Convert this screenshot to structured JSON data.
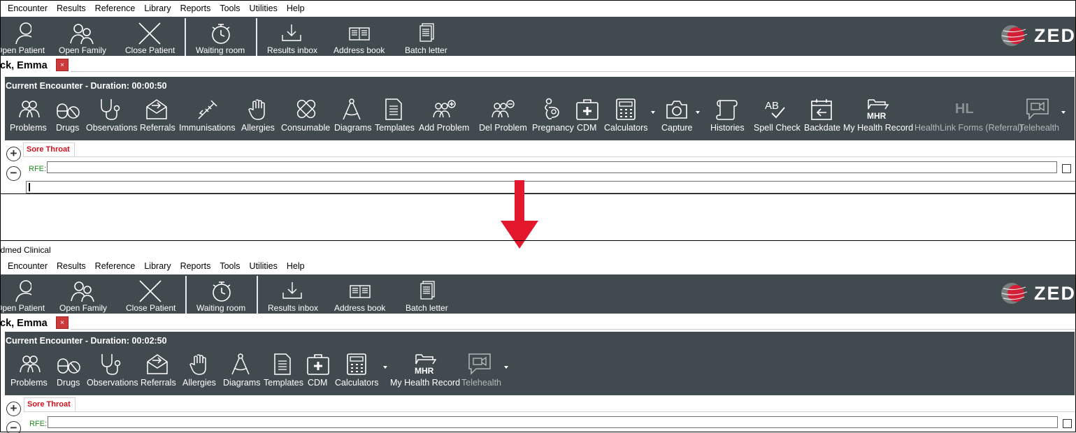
{
  "app": {
    "title": "edmed Clinical"
  },
  "menu": [
    "Encounter",
    "Results",
    "Reference",
    "Library",
    "Reports",
    "Tools",
    "Utilities",
    "Help"
  ],
  "toolbar": {
    "open_patient": "Open Patient",
    "open_family": "Open Family",
    "close_patient": "Close Patient",
    "waiting_room": "Waiting room",
    "results_inbox": "Results inbox",
    "address_book": "Address book",
    "batch_letter": "Batch letter"
  },
  "logo": {
    "text": "ZED"
  },
  "patient": {
    "name": "ck, Emma",
    "close": "×"
  },
  "encounter_top": {
    "title": "Current Encounter - Duration: 00:00:50",
    "buttons": {
      "problems": "Problems",
      "drugs": "Drugs",
      "observations": "Observations",
      "referrals": "Referrals",
      "immunisations": "Immunisations",
      "allergies": "Allergies",
      "consumable": "Consumable",
      "diagrams": "Diagrams",
      "templates": "Templates",
      "add_problem": "Add Problem",
      "del_problem": "Del Problem",
      "pregnancy": "Pregnancy",
      "cdm": "CDM",
      "calculators": "Calculators",
      "capture": "Capture",
      "histories": "Histories",
      "spell_check": "Spell Check",
      "backdate": "Backdate",
      "my_health_record": "My Health Record",
      "healthlink": "HealthLink Forms (Referral)",
      "telehealth": "Telehealth"
    }
  },
  "encounter_bottom": {
    "title": "Current Encounter - Duration: 00:02:50",
    "buttons": {
      "problems": "Problems",
      "drugs": "Drugs",
      "observations": "Observations",
      "referrals": "Referrals",
      "allergies": "Allergies",
      "diagrams": "Diagrams",
      "templates": "Templates",
      "cdm": "CDM",
      "calculators": "Calculators",
      "my_health_record": "My Health Record",
      "telehealth": "Telehealth"
    }
  },
  "icons": {
    "mhr": "MHR",
    "hl": "HL",
    "ab": "AB"
  },
  "tab": {
    "label": "Sore Throat"
  },
  "rfe": {
    "label": "RFE:",
    "value": ""
  },
  "colors": {
    "toolbar_bg": "#414a4f",
    "tab_text": "#d0111b",
    "rfe_label": "#1e8a1e",
    "arrow": "#e3182d"
  }
}
